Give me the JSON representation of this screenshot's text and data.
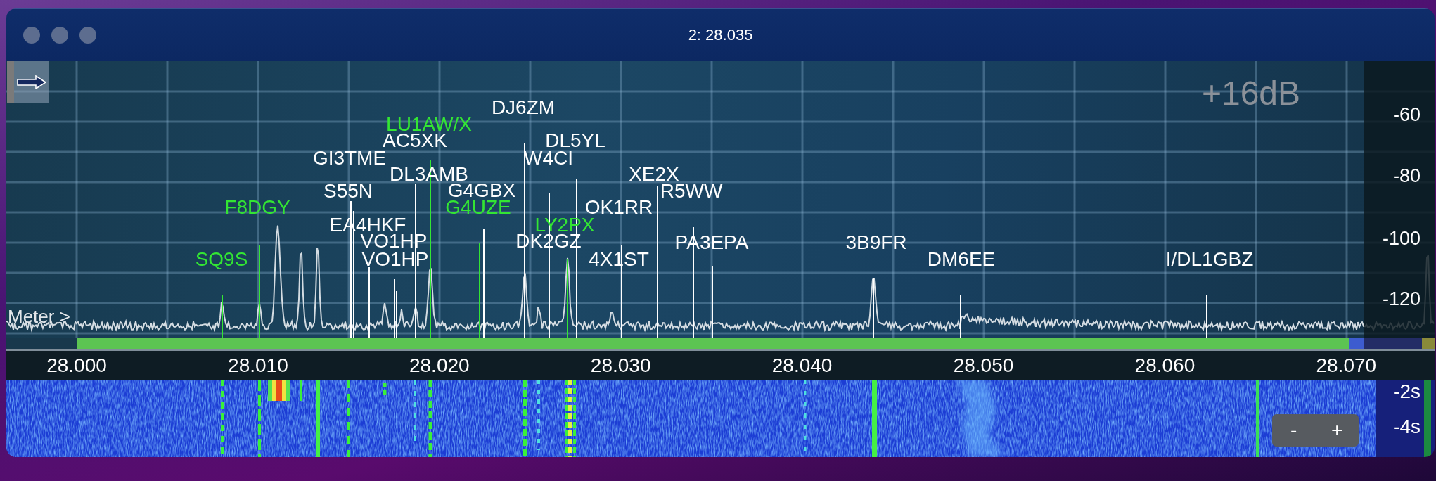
{
  "window": {
    "title": "2: 28.035"
  },
  "spectrum": {
    "gain": "+16dB",
    "meter": "Meter >",
    "db_ticks": [
      "-60",
      "-80",
      "-100",
      "-120"
    ],
    "spots": [
      {
        "call": "DJ6ZM",
        "color": "#ffffff"
      },
      {
        "call": "LU1AW/X",
        "color": "#33e633"
      },
      {
        "call": "AC5XK",
        "color": "#ffffff"
      },
      {
        "call": "DL5YL",
        "color": "#ffffff"
      },
      {
        "call": "GI3TME",
        "color": "#ffffff"
      },
      {
        "call": "W4CI",
        "color": "#ffffff"
      },
      {
        "call": "DL3AMB",
        "color": "#ffffff"
      },
      {
        "call": "XE2X",
        "color": "#ffffff"
      },
      {
        "call": "S55N",
        "color": "#ffffff"
      },
      {
        "call": "G4GBX",
        "color": "#ffffff"
      },
      {
        "call": "R5WW",
        "color": "#ffffff"
      },
      {
        "call": "F8DGY",
        "color": "#33e633"
      },
      {
        "call": "G4UZE",
        "color": "#33e633"
      },
      {
        "call": "OK1RR",
        "color": "#ffffff"
      },
      {
        "call": "EA4HKF",
        "color": "#ffffff"
      },
      {
        "call": "LY2PX",
        "color": "#33e633"
      },
      {
        "call": "VO1HP",
        "color": "#ffffff"
      },
      {
        "call": "DK2GZ",
        "color": "#ffffff"
      },
      {
        "call": "PA3EPA",
        "color": "#ffffff"
      },
      {
        "call": "3B9FR",
        "color": "#ffffff"
      },
      {
        "call": "SQ9S",
        "color": "#33e633"
      },
      {
        "call": "VO1HP",
        "color": "#ffffff"
      },
      {
        "call": "4X1ST",
        "color": "#ffffff"
      },
      {
        "call": "DM6EE",
        "color": "#ffffff"
      },
      {
        "call": "I/DL1GBZ",
        "color": "#ffffff"
      }
    ]
  },
  "frequency_axis": {
    "ticks": [
      "28.000",
      "28.010",
      "28.020",
      "28.030",
      "28.040",
      "28.050",
      "28.060",
      "28.070"
    ]
  },
  "waterfall": {
    "time_ticks": [
      "-2s",
      "-4s"
    ],
    "zoom_buttons": [
      "-",
      "+"
    ]
  }
}
